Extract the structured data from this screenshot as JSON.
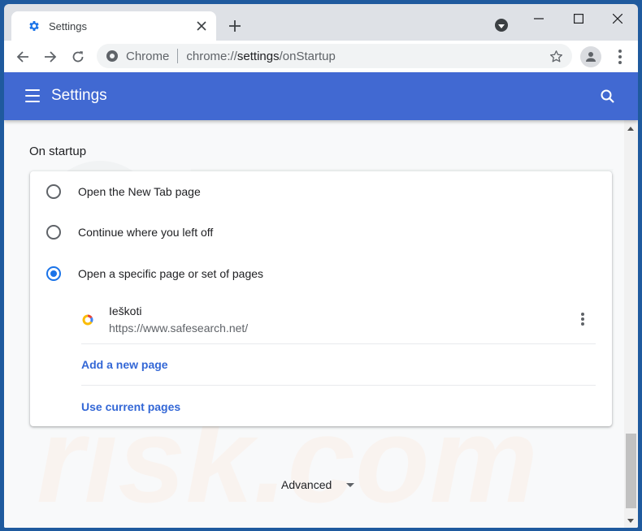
{
  "tab": {
    "title": "Settings",
    "icon": "gear-icon",
    "close_icon": "close-icon",
    "new_tab_icon": "plus-icon"
  },
  "window_controls": {
    "minimize": "minimize-icon",
    "maximize": "maximize-icon",
    "close": "close-icon"
  },
  "toolbar": {
    "back_icon": "back-arrow-icon",
    "forward_icon": "forward-arrow-icon",
    "reload_icon": "reload-icon",
    "chip_label": "Chrome",
    "url_scheme": "chrome://",
    "url_host": "settings",
    "url_path": "/onStartup",
    "bookmark_icon": "star-icon",
    "profile_icon": "person-icon",
    "menu_icon": "kebab-menu-icon"
  },
  "header": {
    "title": "Settings",
    "menu_icon": "hamburger-icon",
    "search_icon": "search-icon",
    "color": "#4169d2"
  },
  "on_startup": {
    "section_title": "On startup",
    "options": [
      {
        "label": "Open the New Tab page",
        "checked": false
      },
      {
        "label": "Continue where you left off",
        "checked": false
      },
      {
        "label": "Open a specific page or set of pages",
        "checked": true
      }
    ],
    "pages": [
      {
        "name": "Ieškoti",
        "url": "https://www.safesearch.net/"
      }
    ],
    "add_page_label": "Add a new page",
    "use_current_label": "Use current pages"
  },
  "advanced": {
    "label": "Advanced"
  },
  "accent_color": "#1a73e8",
  "link_color": "#3367d6"
}
